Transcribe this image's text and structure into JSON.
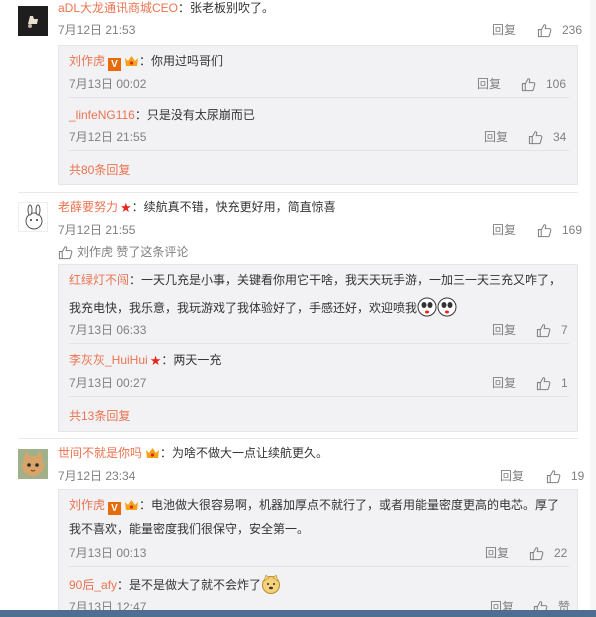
{
  "actions": {
    "reply": "回复",
    "like_label": "赞"
  },
  "comments": [
    {
      "user": "aDL大龙通讯商城CEO",
      "text": "：张老板别吹了。",
      "time": "7月12日 21:53",
      "likes": "236",
      "replies": [
        {
          "user": "刘作虎",
          "text": "：你用过吗哥们",
          "time": "7月13日 00:02",
          "likes": "106"
        },
        {
          "user": "_linfeNG116",
          "text": "：只是没有太尿崩而已",
          "time": "7月12日 21:55",
          "likes": "34"
        }
      ],
      "more": "共80条回复"
    },
    {
      "user": "老薛要努力",
      "text": "：续航真不错，快充更好用，简直惊喜",
      "time": "7月12日 21:55",
      "likes": "169",
      "liked_by": "刘作虎 赞了这条评论",
      "replies": [
        {
          "user": "红绿灯不闯",
          "text_line1": "：一天几充是小事，关键看你用它干啥，我天天玩手游，一加三一天三充又咋了，",
          "text_line2": "我充电快，我乐意，我玩游戏了我体验好了，手感还好，欢迎喷我",
          "time": "7月13日 06:33",
          "likes": "7"
        },
        {
          "user": "李灰灰_HuiHui",
          "text": "：两天一充",
          "time": "7月13日 00:27",
          "likes": "1"
        }
      ],
      "more": "共13条回复"
    },
    {
      "user": "世间不就是你吗",
      "text": "：为啥不做大一点让续航更久。",
      "time": "7月12日 23:34",
      "likes": "19",
      "replies": [
        {
          "user": "刘作虎",
          "text_line1": "：电池做大很容易啊，机器加厚点不就行了，或者用能量密度更高的电芯。厚了",
          "text_line2": "我不喜欢，能量密度我们很保守，安全第一。",
          "time": "7月13日 00:13",
          "likes": "22"
        },
        {
          "user": "90后_afy",
          "text": "：是不是做大了就不会炸了",
          "time": "7月13日 12:47",
          "likes": "赞"
        }
      ]
    }
  ],
  "colors": {
    "link": "#eb7350",
    "muted": "#808080",
    "reply_bg": "#f2f2f5"
  }
}
